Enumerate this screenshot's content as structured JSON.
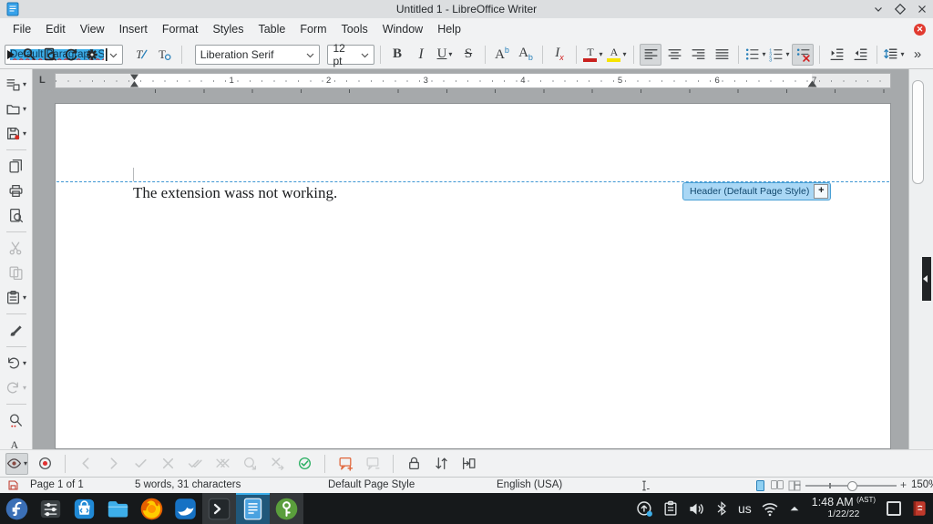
{
  "titlebar": {
    "title": "Untitled 1 - LibreOffice Writer"
  },
  "menubar": {
    "items": [
      "File",
      "Edit",
      "View",
      "Insert",
      "Format",
      "Styles",
      "Table",
      "Form",
      "Tools",
      "Window",
      "Help"
    ]
  },
  "toolbar": {
    "paragraph_style_value": "Default Paragraph Style",
    "font_name_value": "Liberation Serif",
    "font_size_value": "12 pt",
    "style_buttons": [
      {
        "icon": "update-style"
      },
      {
        "icon": "new-style"
      }
    ],
    "format_buttons": [
      {
        "icon": "bold",
        "glyph": "B"
      },
      {
        "icon": "italic",
        "glyph": "I"
      },
      {
        "icon": "underline",
        "glyph": "U",
        "dropdown": true
      },
      {
        "icon": "strikethrough",
        "glyph": "S"
      },
      {
        "type": "divider"
      },
      {
        "icon": "superscript",
        "glyph": "A",
        "glyph2": "b",
        "g2": "sup"
      },
      {
        "icon": "subscript",
        "glyph": "A",
        "glyph2": "b",
        "g2": "sub"
      },
      {
        "type": "divider"
      },
      {
        "icon": "clear-formatting",
        "glyph": "I",
        "glyph2": "x",
        "g2": "sub"
      },
      {
        "type": "divider"
      },
      {
        "icon": "font-color",
        "glyph": "T",
        "bar": "#c9211e",
        "dropdown": true
      },
      {
        "icon": "highlight-color",
        "glyph": "A",
        "bar": "#f7e400",
        "dropdown": true
      },
      {
        "type": "divider"
      },
      {
        "icon": "align-left",
        "active": true
      },
      {
        "icon": "align-center"
      },
      {
        "icon": "align-right"
      },
      {
        "icon": "align-justify"
      },
      {
        "type": "divider"
      },
      {
        "icon": "unordered-list",
        "dropdown": true
      },
      {
        "icon": "ordered-list",
        "dropdown": true
      },
      {
        "icon": "no-list",
        "active": true
      },
      {
        "type": "divider"
      },
      {
        "icon": "increase-indent"
      },
      {
        "icon": "decrease-indent"
      },
      {
        "type": "divider"
      },
      {
        "icon": "line-spacing",
        "dropdown": true
      },
      {
        "icon": "toolbar-overflow",
        "glyph": "»"
      }
    ]
  },
  "left_toolbar": [
    {
      "icon": "new-document",
      "dropdown": true
    },
    {
      "icon": "open-file",
      "dropdown": true
    },
    {
      "icon": "save",
      "dropdown": true
    },
    {
      "type": "divider"
    },
    {
      "icon": "export-pdf"
    },
    {
      "icon": "print"
    },
    {
      "icon": "print-preview"
    },
    {
      "type": "divider"
    },
    {
      "icon": "cut",
      "disabled": true
    },
    {
      "icon": "copy",
      "disabled": true
    },
    {
      "icon": "paste",
      "dropdown": true
    },
    {
      "type": "divider"
    },
    {
      "icon": "clone-formatting"
    },
    {
      "type": "divider"
    },
    {
      "icon": "undo",
      "dropdown": true
    },
    {
      "icon": "redo",
      "disabled": true,
      "dropdown": true
    },
    {
      "type": "divider"
    },
    {
      "icon": "find-replace"
    },
    {
      "icon": "spelling"
    },
    {
      "icon": "sidebar-overflow",
      "glyph": "»"
    }
  ],
  "ruler": {
    "inch_labels": [
      "1",
      "2",
      "3",
      "4",
      "5",
      "6",
      "7"
    ]
  },
  "document": {
    "body_text": "The extension wass not working.",
    "header_tag_label": "Header (Default Page Style)",
    "header_tag_button": "+"
  },
  "track_toolbar": [
    {
      "icon": "show-track-changes",
      "active": true,
      "dropdown": true
    },
    {
      "icon": "record-track-changes"
    },
    {
      "type": "divider"
    },
    {
      "icon": "previous-track-change",
      "disabled": true
    },
    {
      "icon": "next-track-change",
      "disabled": true
    },
    {
      "icon": "accept-track-change",
      "disabled": true
    },
    {
      "icon": "reject-track-change",
      "disabled": true
    },
    {
      "icon": "accept-all-track-changes",
      "disabled": true
    },
    {
      "icon": "reject-all-track-changes",
      "disabled": true
    },
    {
      "icon": "accept-and-next",
      "disabled": true
    },
    {
      "icon": "reject-and-next",
      "disabled": true
    },
    {
      "icon": "manage-track-changes"
    },
    {
      "type": "divider"
    },
    {
      "icon": "insert-comment"
    },
    {
      "icon": "show-comments",
      "disabled": true
    },
    {
      "type": "divider"
    },
    {
      "icon": "protect-changes"
    },
    {
      "icon": "compare-documents"
    },
    {
      "icon": "merge-documents"
    }
  ],
  "statusbar": {
    "page": "Page 1 of 1",
    "word_count": "5 words, 31 characters",
    "page_style": "Default Page Style",
    "language": "English (USA)",
    "zoom_level": "150%"
  },
  "taskbar": {
    "apps": [
      {
        "icon": "fedora-launcher"
      },
      {
        "icon": "system-settings"
      },
      {
        "icon": "discover-store"
      },
      {
        "icon": "file-manager"
      },
      {
        "icon": "firefox"
      },
      {
        "icon": "falkon"
      },
      {
        "icon": "konsole",
        "running": true
      },
      {
        "icon": "libreoffice-writer",
        "active": true
      },
      {
        "icon": "keepassxc",
        "running": true
      }
    ],
    "tray": [
      {
        "icon": "software-updates"
      },
      {
        "icon": "clipboard"
      },
      {
        "icon": "volume"
      },
      {
        "icon": "bluetooth"
      },
      {
        "icon": "keyboard-layout",
        "text": "us"
      },
      {
        "icon": "network-wifi"
      },
      {
        "icon": "expand-tray"
      }
    ],
    "clock": {
      "time": "1:48 AM",
      "timezone": "(AST)",
      "date": "1/22/22"
    }
  },
  "colors": {
    "accent": "#3daee9",
    "selection": "#3daee9",
    "font_color_bar": "#c9211e",
    "highlight_bar": "#f7e400"
  }
}
